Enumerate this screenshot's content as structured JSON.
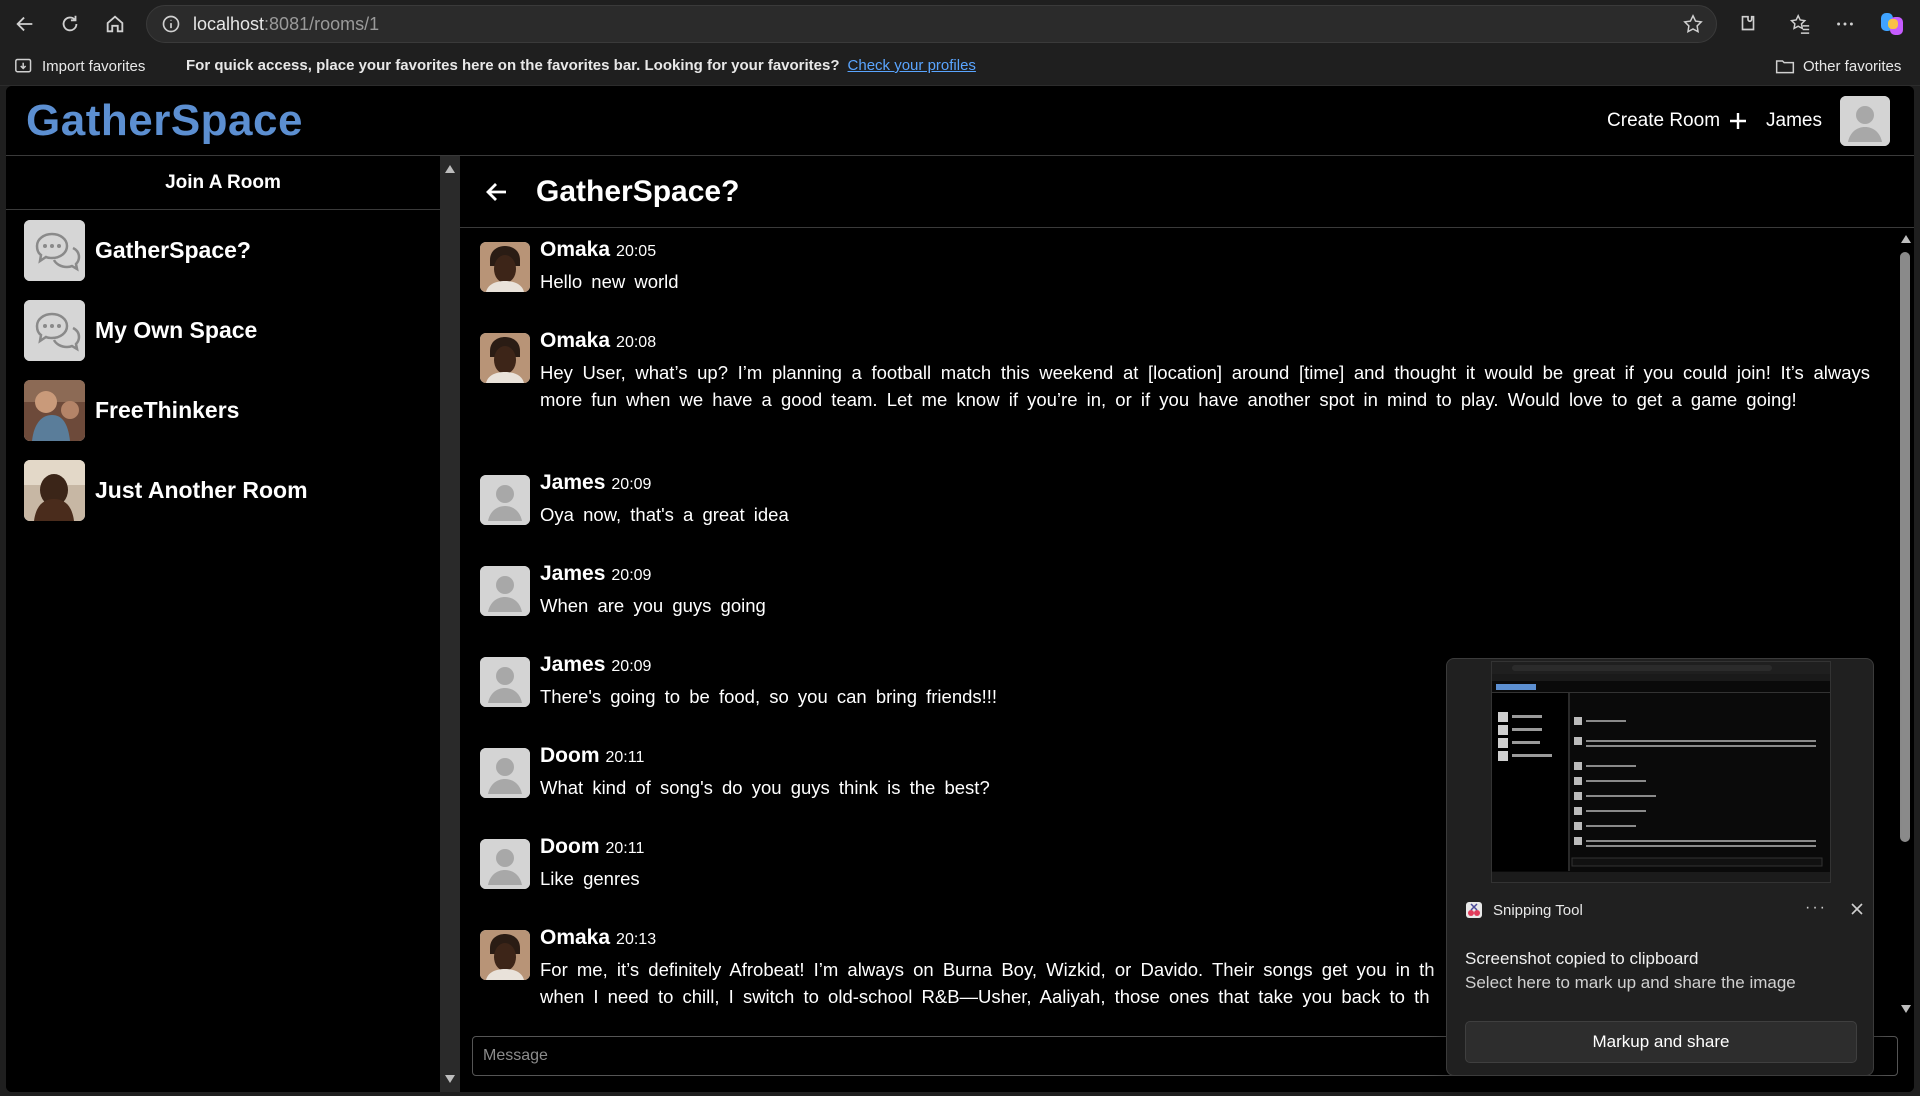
{
  "browser": {
    "url_host": "localhost",
    "url_rest": ":8081/rooms/1",
    "import_favorites": "Import favorites",
    "favbar_message": "For quick access, place your favorites here on the favorites bar. Looking for your favorites?",
    "favbar_link": "Check your profiles",
    "other_favorites": "Other favorites"
  },
  "header": {
    "logo": "GatherSpace",
    "create_room": "Create Room",
    "user_name": "James"
  },
  "sidebar": {
    "title": "Join A Room",
    "rooms": [
      {
        "name": "GatherSpace?",
        "icon": "chat-bubbles-icon"
      },
      {
        "name": "My Own Space",
        "icon": "chat-bubbles-icon"
      },
      {
        "name": "FreeThinkers",
        "icon": "room-photo"
      },
      {
        "name": "Just Another Room",
        "icon": "room-photo"
      }
    ]
  },
  "chat": {
    "title": "GatherSpace?",
    "messages": [
      {
        "author": "Omaka",
        "time": "20:05",
        "text": "Hello new world",
        "avatar": "photo"
      },
      {
        "author": "Omaka",
        "time": "20:08",
        "text": "Hey User, what’s up? I’m planning a football match this weekend at [location] around [time] and thought it would be great if you could join! It’s always more fun when we have a good team. Let me know if you’re in, or if you have another spot in mind to play. Would love to get a game going!",
        "avatar": "photo"
      },
      {
        "author": "James",
        "time": "20:09",
        "text": "Oya now, that's a great idea",
        "avatar": "default"
      },
      {
        "author": "James",
        "time": "20:09",
        "text": "When are you guys going",
        "avatar": "default"
      },
      {
        "author": "James",
        "time": "20:09",
        "text": "There's going to be food, so you can bring friends!!!",
        "avatar": "default"
      },
      {
        "author": "Doom",
        "time": "20:11",
        "text": "What kind of song's do you guys think is the best?",
        "avatar": "default"
      },
      {
        "author": "Doom",
        "time": "20:11",
        "text": "Like genres",
        "avatar": "default"
      },
      {
        "author": "Omaka",
        "time": "20:13",
        "text": "For me, it’s definitely Afrobeat! I’m always on Burna Boy, Wizkid, or Davido. Their songs get you in th",
        "text2": "when I need to chill, I switch to old-school R&B—Usher, Aaliyah, those ones that take you back to th",
        "avatar": "photo"
      }
    ],
    "composer_placeholder": "Message"
  },
  "toast": {
    "app_name": "Snipping Tool",
    "title": "Screenshot copied to clipboard",
    "subtitle": "Select here to mark up and share the image",
    "button": "Markup and share",
    "more": "···"
  }
}
